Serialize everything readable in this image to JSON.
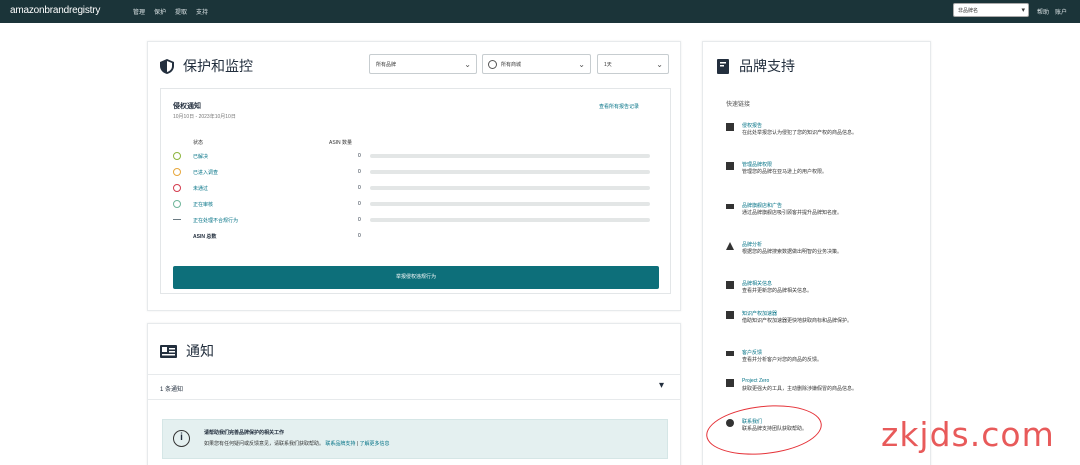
{
  "topbar": {
    "logo": "amazonbrandregistry",
    "nav": [
      "管理",
      "保护",
      "提取",
      "支持"
    ],
    "brand_select": "非品牌名",
    "right": [
      "帮助",
      "账户"
    ]
  },
  "protection": {
    "title": "保护和监控",
    "filter_brand": "所有品牌",
    "filter_market": "所有商城",
    "filter_period": "1天",
    "panel_title": "侵权通知",
    "panel_sub": "10月10日 - 2023年10月10日",
    "panel_link": "查看所有报告记录",
    "col_status": "状态",
    "col_asin": "ASIN 数量",
    "rows": [
      {
        "label": "已解决",
        "num": "0",
        "color": "#8db53e"
      },
      {
        "label": "已进入调查",
        "num": "0",
        "color": "#e7a73c"
      },
      {
        "label": "未通过",
        "num": "0",
        "color": "#d43b4d"
      },
      {
        "label": "正在审核",
        "num": "0",
        "color": "#6fb59a"
      },
      {
        "label": "正在处理不合规行为",
        "num": "0",
        "color": "#6b7a82"
      },
      {
        "label": "ASIN 总数",
        "num": "0",
        "color": ""
      }
    ],
    "cta": "举报侵权违规行为"
  },
  "notifications": {
    "title": "通知",
    "count_label": "1 条通知",
    "alert_title": "请帮助我们完善品牌保护的相关工作",
    "alert_body": "如果您有任何疑问或反馈意见，请联系我们获取帮助。",
    "alert_link1": "联系品牌支持",
    "alert_link2": "了解更多信息"
  },
  "support": {
    "title": "品牌支持",
    "subtitle": "快速链接",
    "items": [
      {
        "title": "侵权报告",
        "desc": "在此处举报您认为侵犯了您的知识产权的商品信息。",
        "icon": "folder"
      },
      {
        "title": "管理品牌权限",
        "desc": "管理您的品牌在亚马逊上的用户权限。",
        "icon": "doc"
      },
      {
        "title": "品牌旗舰店和广告",
        "desc": "通过品牌旗舰店吸引顾客并提升品牌知名度。",
        "icon": "video"
      },
      {
        "title": "品牌分析",
        "desc": "根据您的品牌搜索数据做出明智的业务决策。",
        "icon": "alert"
      },
      {
        "title": "品牌相关信息",
        "desc": "查看并更新您的品牌相关信息。",
        "icon": "folder"
      },
      {
        "title": "知识产权加速器",
        "desc": "借助知识产权加速器更快地获取商标和品牌保护。",
        "icon": "doc"
      },
      {
        "title": "客户反馈",
        "desc": "查看并分析客户对您的商品的反馈。",
        "icon": "video"
      },
      {
        "title": "Project Zero",
        "desc": "获取更强大的工具，主动删除涉嫌假冒的商品信息。",
        "icon": "case"
      },
      {
        "title": "联系我们",
        "desc": "联系品牌支持团队获取帮助。",
        "icon": "globe"
      }
    ]
  },
  "watermark": "zkjds.com"
}
